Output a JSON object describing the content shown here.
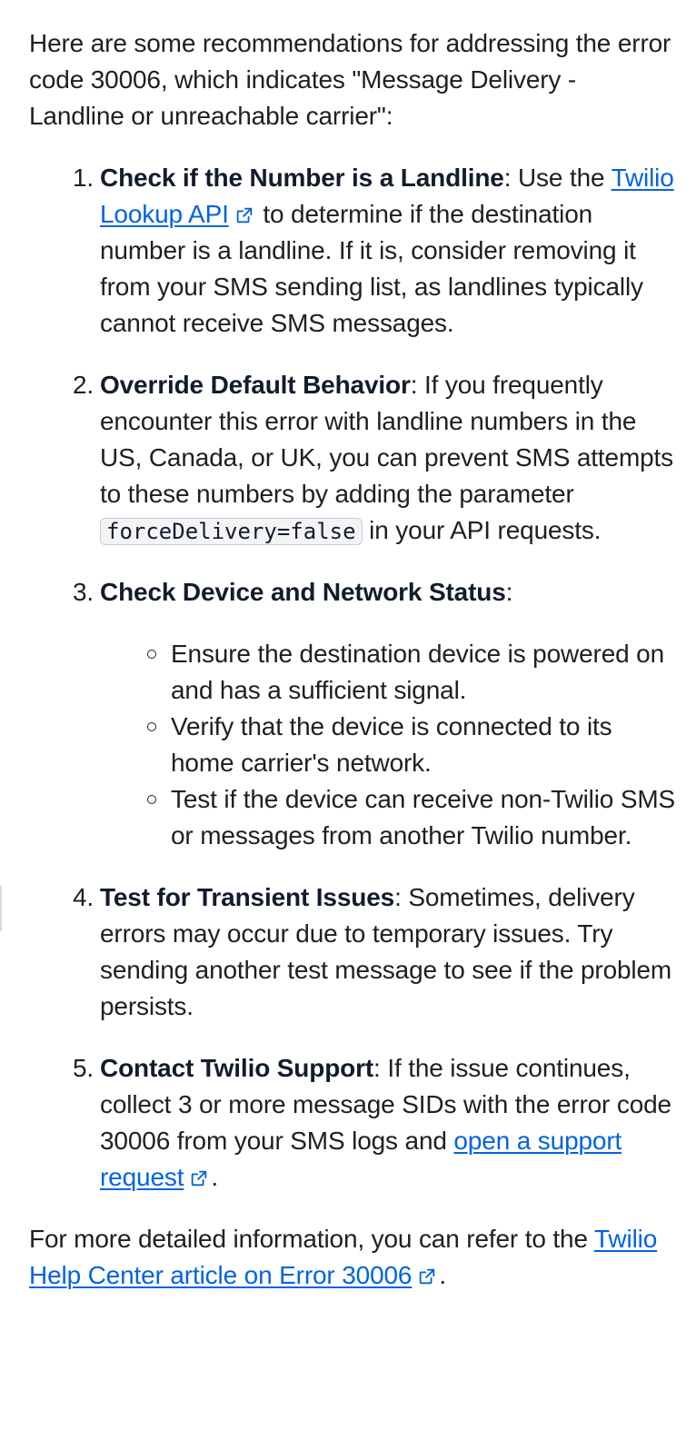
{
  "intro": "Here are some recommendations for addressing the error code 30006, which indicates \"Message Delivery - Landline or unreachable carrier\":",
  "steps": [
    {
      "number": "1.",
      "title": "Check if the Number is a Landline",
      "colon": ":",
      "text_before": " Use the ",
      "link": "Twilio Lookup API",
      "text_after": " to determine if the destination number is a landline. If it is, consider removing it from your SMS sending list, as landlines typically cannot receive SMS messages."
    },
    {
      "number": "2.",
      "title": "Override Default Behavior",
      "colon": ":",
      "text_before": " If you frequently encounter this error with landline numbers in the US, Canada, or UK, you can prevent SMS attempts to these numbers by adding the parameter ",
      "code": "forceDelivery=false",
      "text_after": " in your API requests."
    },
    {
      "number": "3.",
      "title": "Check Device and Network Status",
      "colon": ":",
      "subitems": [
        "Ensure the destination device is powered on and has a sufficient signal.",
        "Verify that the device is connected to its home carrier's network.",
        "Test if the device can receive non-Twilio SMS or messages from another Twilio number."
      ]
    },
    {
      "number": "4.",
      "title": "Test for Transient Issues",
      "colon": ":",
      "text": " Sometimes, delivery errors may occur due to temporary issues. Try sending another test message to see if the problem persists."
    },
    {
      "number": "5.",
      "title": "Contact Twilio Support",
      "colon": ":",
      "text_before": " If the issue continues, collect 3 or more message SIDs with the error code 30006 from your SMS logs and ",
      "link": "open a support request",
      "text_after": "."
    }
  ],
  "footer": {
    "text_before": "For more detailed information, you can refer to the ",
    "link": "Twilio Help Center article on Error 30006",
    "text_after": "."
  },
  "colors": {
    "link": "#0263e0",
    "text": "#1f1f1f",
    "code_bg": "#f4f4f6",
    "code_border": "#cacdd8"
  },
  "icons": {
    "external_link": "external-link-icon"
  }
}
